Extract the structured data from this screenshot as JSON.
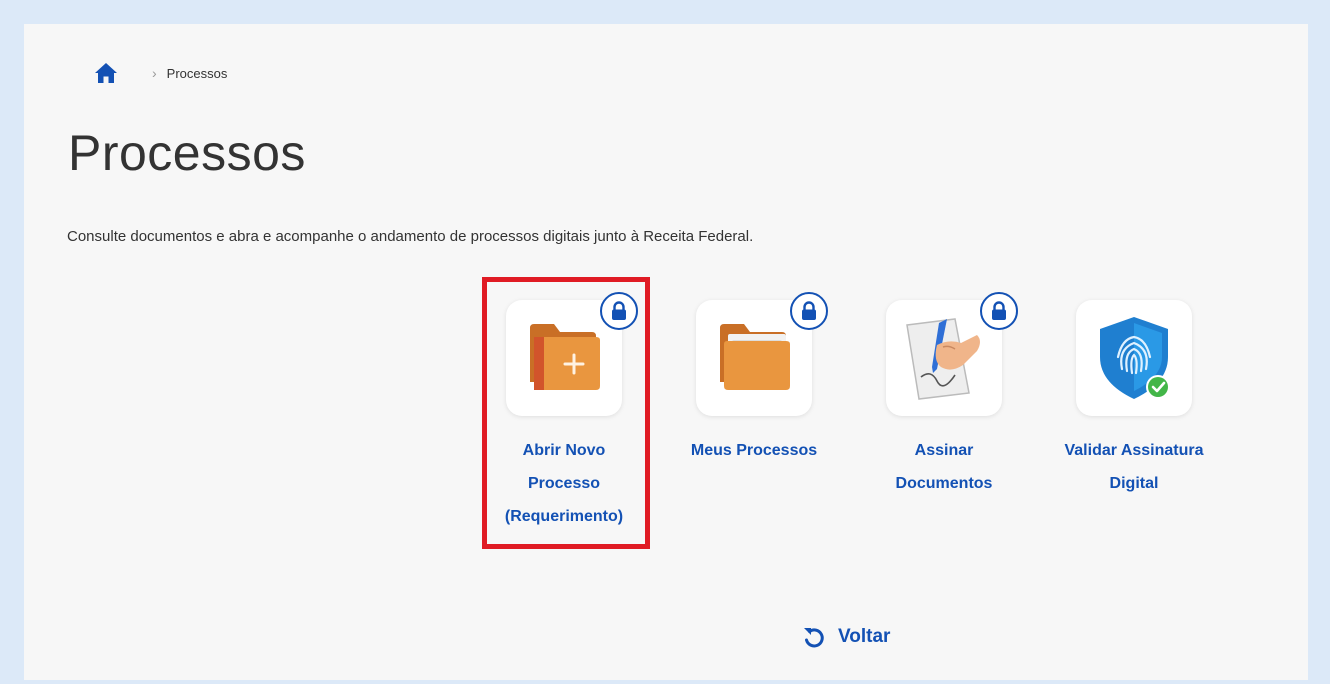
{
  "breadcrumb": {
    "current": "Processos"
  },
  "page": {
    "title": "Processos",
    "description": "Consulte documentos e abra e acompanhe o andamento de processos digitais junto à Receita Federal."
  },
  "services": [
    {
      "label_lines": [
        "Abrir Novo",
        "Processo",
        "(Requerimento)"
      ],
      "icon": "folder-plus-icon",
      "locked": true,
      "highlighted": true
    },
    {
      "label_lines": [
        "Meus Processos"
      ],
      "icon": "folder-icon",
      "locked": true
    },
    {
      "label_lines": [
        "Assinar",
        "Documentos"
      ],
      "icon": "hand-signing-icon",
      "locked": true
    },
    {
      "label_lines": [
        "Validar Assinatura",
        "Digital"
      ],
      "icon": "fingerprint-shield-icon",
      "locked": false
    }
  ],
  "actions": {
    "back_label": "Voltar"
  },
  "colors": {
    "accent": "#1351b4",
    "highlight": "#e01b24",
    "folder": "#e9963f"
  }
}
